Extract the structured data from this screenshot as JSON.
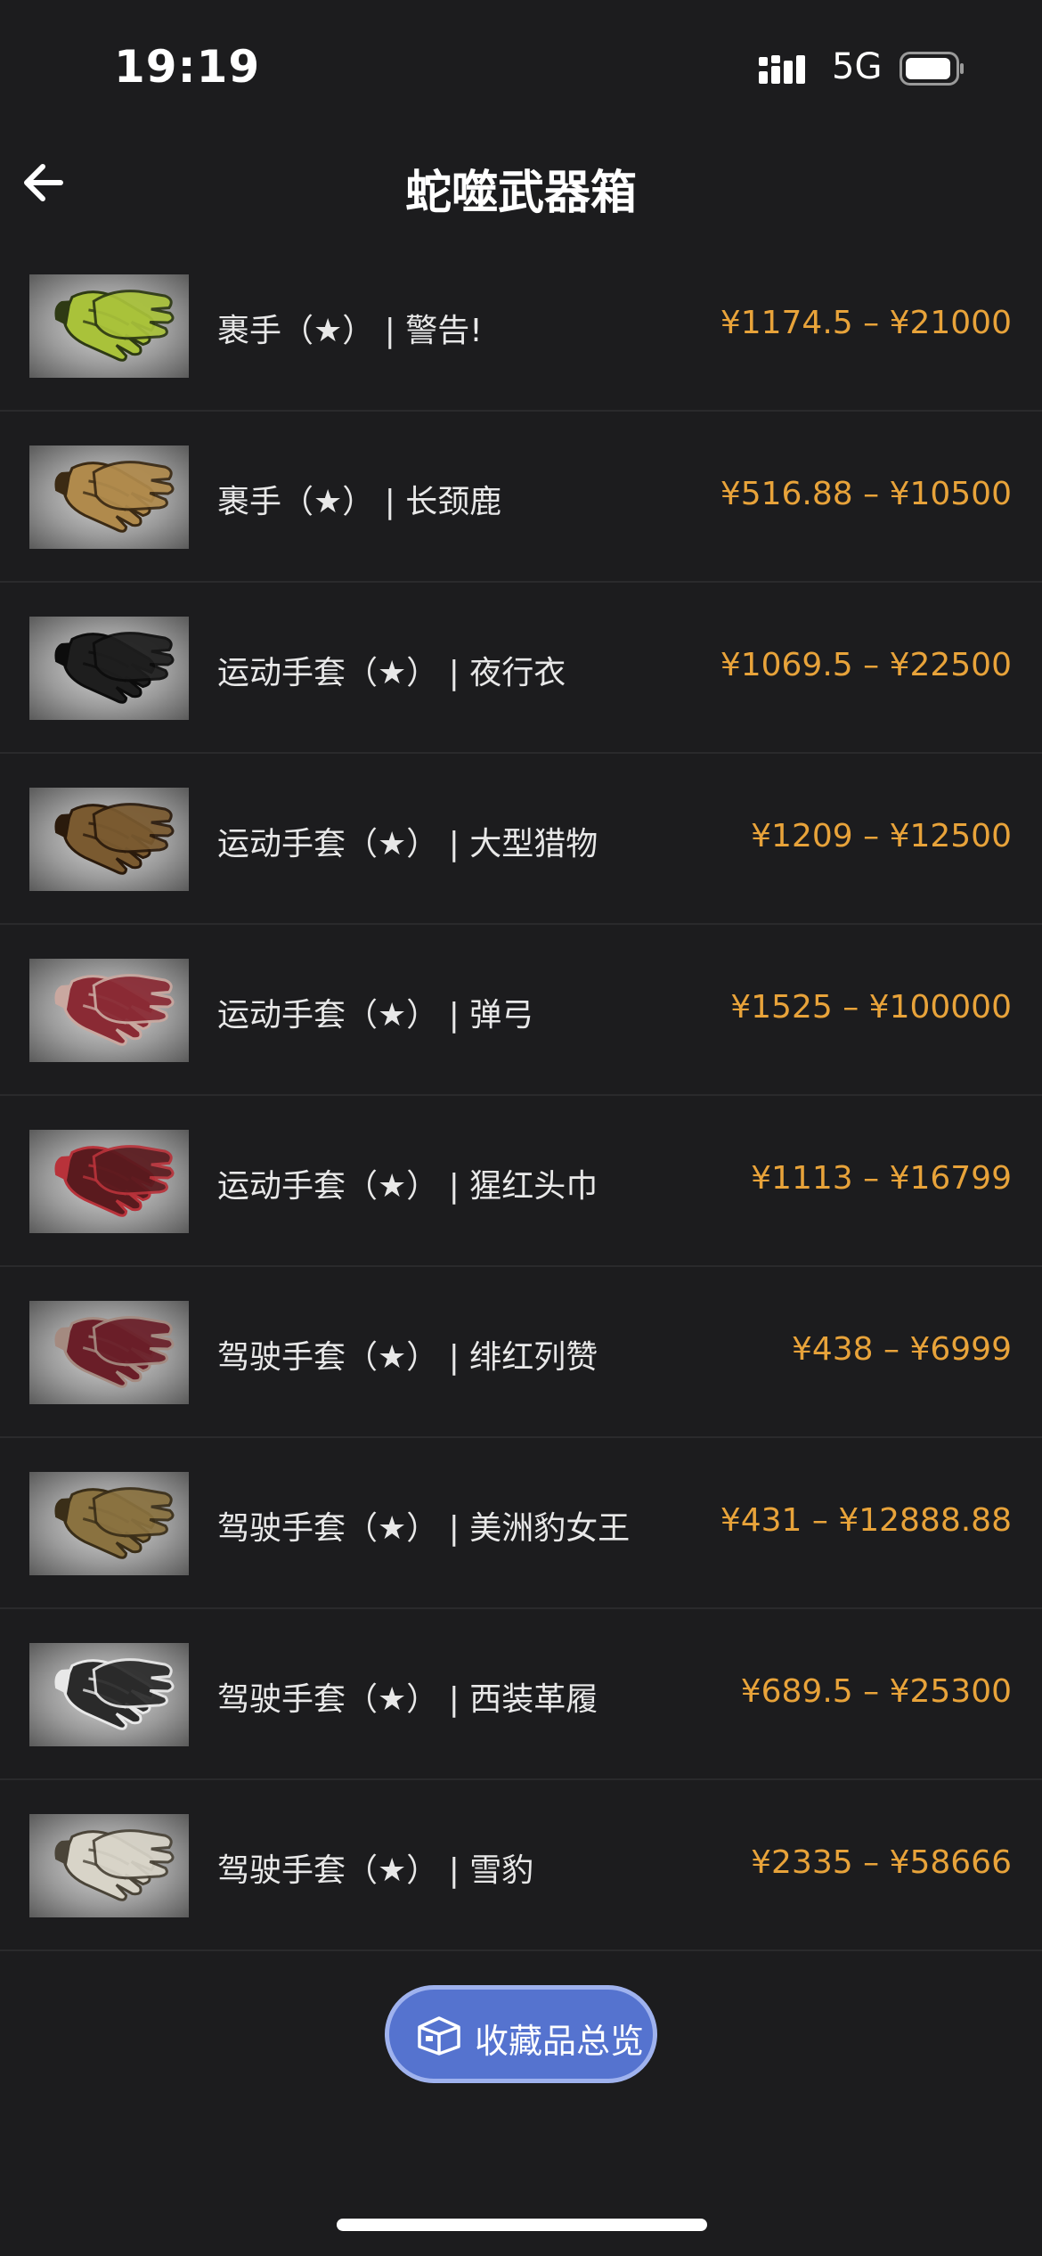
{
  "status_bar": {
    "time": "19:19",
    "network": "5G",
    "signal_icon": "signal-bars-icon",
    "battery_icon": "battery-icon"
  },
  "nav": {
    "title": "蛇噬武器箱",
    "back_icon": "arrow-left-icon"
  },
  "items": [
    {
      "name": "裹手（★） | 警告!",
      "price": "¥1174.5 – ¥21000",
      "glove_color": "#a9c23a",
      "accent_color": "#2e3a14"
    },
    {
      "name": "裹手（★） | 长颈鹿",
      "price": "¥516.88 – ¥10500",
      "glove_color": "#b08a4c",
      "accent_color": "#3b2a14"
    },
    {
      "name": "运动手套（★） | 夜行衣",
      "price": "¥1069.5 – ¥22500",
      "glove_color": "#1e1e1e",
      "accent_color": "#0c0c0c"
    },
    {
      "name": "运动手套（★） | 大型猎物",
      "price": "¥1209 – ¥12500",
      "glove_color": "#7a5a30",
      "accent_color": "#2a1a0c"
    },
    {
      "name": "运动手套（★） | 弹弓",
      "price": "¥1525 – ¥100000",
      "glove_color": "#8a2a34",
      "accent_color": "#c9a8a0"
    },
    {
      "name": "运动手套（★） | 猩红头巾",
      "price": "¥1113 – ¥16799",
      "glove_color": "#5a1a1e",
      "accent_color": "#b8323a"
    },
    {
      "name": "驾驶手套（★） | 绯红列赞",
      "price": "¥438 – ¥6999",
      "glove_color": "#6a1e28",
      "accent_color": "#a48a80"
    },
    {
      "name": "驾驶手套（★） | 美洲豹女王",
      "price": "¥431 – ¥12888.88",
      "glove_color": "#8a7240",
      "accent_color": "#3a2e18"
    },
    {
      "name": "驾驶手套（★） | 西装革履",
      "price": "¥689.5 – ¥25300",
      "glove_color": "#2a2a2a",
      "accent_color": "#e8e8e8"
    },
    {
      "name": "驾驶手套（★） | 雪豹",
      "price": "¥2335 – ¥58666",
      "glove_color": "#d8d4c8",
      "accent_color": "#4a4438"
    }
  ],
  "collection_button": {
    "label": "收藏品总览",
    "icon": "case-icon",
    "color": "#5573cf"
  },
  "colors": {
    "background": "#1c1c1e",
    "price": "#e8a33a",
    "text": "#e8e8e8"
  }
}
